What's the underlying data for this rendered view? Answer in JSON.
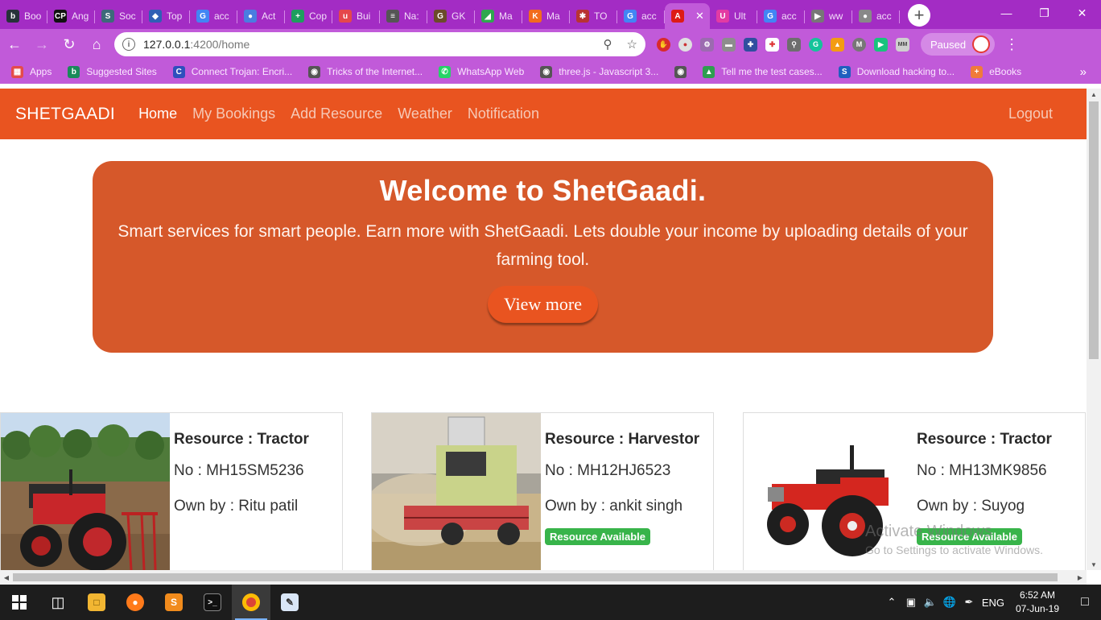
{
  "browser": {
    "tabs": [
      {
        "label": "Boo",
        "icon": "b",
        "color": "#26323a"
      },
      {
        "label": "Ang",
        "icon": "CP",
        "color": "#111111"
      },
      {
        "label": "Soc",
        "icon": "S",
        "color": "#3d6a7a"
      },
      {
        "label": "Top",
        "icon": "◆",
        "color": "#2f5fb5"
      },
      {
        "label": "acc",
        "icon": "G",
        "color": "#4285f4"
      },
      {
        "label": "Act",
        "icon": "●",
        "color": "#4a7de0"
      },
      {
        "label": "Cop",
        "icon": "+",
        "color": "#1e9e5e"
      },
      {
        "label": "Bui",
        "icon": "u",
        "color": "#e5474b"
      },
      {
        "label": "Na:",
        "icon": "≡",
        "color": "#555555"
      },
      {
        "label": "GK",
        "icon": "G",
        "color": "#6b4b2a"
      },
      {
        "label": "Ma",
        "icon": "◢",
        "color": "#2fa84f"
      },
      {
        "label": "Ma",
        "icon": "K",
        "color": "#f26b1d"
      },
      {
        "label": "TO",
        "icon": "✱",
        "color": "#b83333"
      },
      {
        "label": "acc",
        "icon": "G",
        "color": "#4285f4"
      },
      {
        "label": "",
        "icon": "A",
        "color": "#dd1b16",
        "active": true
      },
      {
        "label": "Ult",
        "icon": "U",
        "color": "#e33ba3"
      },
      {
        "label": "acc",
        "icon": "G",
        "color": "#4285f4"
      },
      {
        "label": "ww",
        "icon": "▶",
        "color": "#777777"
      },
      {
        "label": "acc",
        "icon": "●",
        "color": "#888888"
      }
    ],
    "new_tab": "+",
    "url_host": "127.0.0.1",
    "url_path": ":4200/home",
    "profile_status": "Paused",
    "bookmarks": [
      {
        "label": "Apps",
        "icon": "▦",
        "color": "#e44b4b"
      },
      {
        "label": "Suggested Sites",
        "icon": "b",
        "color": "#1a8a5a"
      },
      {
        "label": "Connect Trojan: Encri...",
        "icon": "C",
        "color": "#2e4fbd"
      },
      {
        "label": "Tricks of the Internet...",
        "icon": "◉",
        "color": "#555555"
      },
      {
        "label": "WhatsApp Web",
        "icon": "✆",
        "color": "#25d366"
      },
      {
        "label": "three.js - Javascript 3...",
        "icon": "◉",
        "color": "#555555"
      },
      {
        "label": "",
        "icon": "◉",
        "color": "#555555"
      },
      {
        "label": "Tell me the test cases...",
        "icon": "▲",
        "color": "#2e9e4f"
      },
      {
        "label": "Download hacking to...",
        "icon": "S",
        "color": "#1f5fbf"
      },
      {
        "label": "eBooks",
        "icon": "+",
        "color": "#f07b3a"
      }
    ]
  },
  "app": {
    "brand": "SHETGAADI",
    "nav": [
      "Home",
      "My Bookings",
      "Add Resource",
      "Weather",
      "Notification"
    ],
    "logout": "Logout",
    "jumbotron": {
      "title": "Welcome to ShetGaadi.",
      "text": "Smart services for smart people. Earn more with ShetGaadi. Lets double your income by uploading details of your farming tool.",
      "button": "View more"
    },
    "cards": [
      {
        "resource": "Resource : Tractor",
        "number": "No : MH15SM5236",
        "owner": "Own by : Ritu patil",
        "badge": ""
      },
      {
        "resource": "Resource : Harvestor",
        "number": "No : MH12HJ6523",
        "owner": "Own by : ankit singh",
        "badge": "Resource Available"
      },
      {
        "resource": "Resource : Tractor",
        "number": "No : MH13MK9856",
        "owner": "Own by : Suyog",
        "badge": "Resource Available"
      }
    ]
  },
  "os": {
    "watermark_title": "Activate Windows",
    "watermark_sub": "Go to Settings to activate Windows.",
    "language": "ENG",
    "time": "6:52 AM",
    "date": "07-Jun-19"
  }
}
